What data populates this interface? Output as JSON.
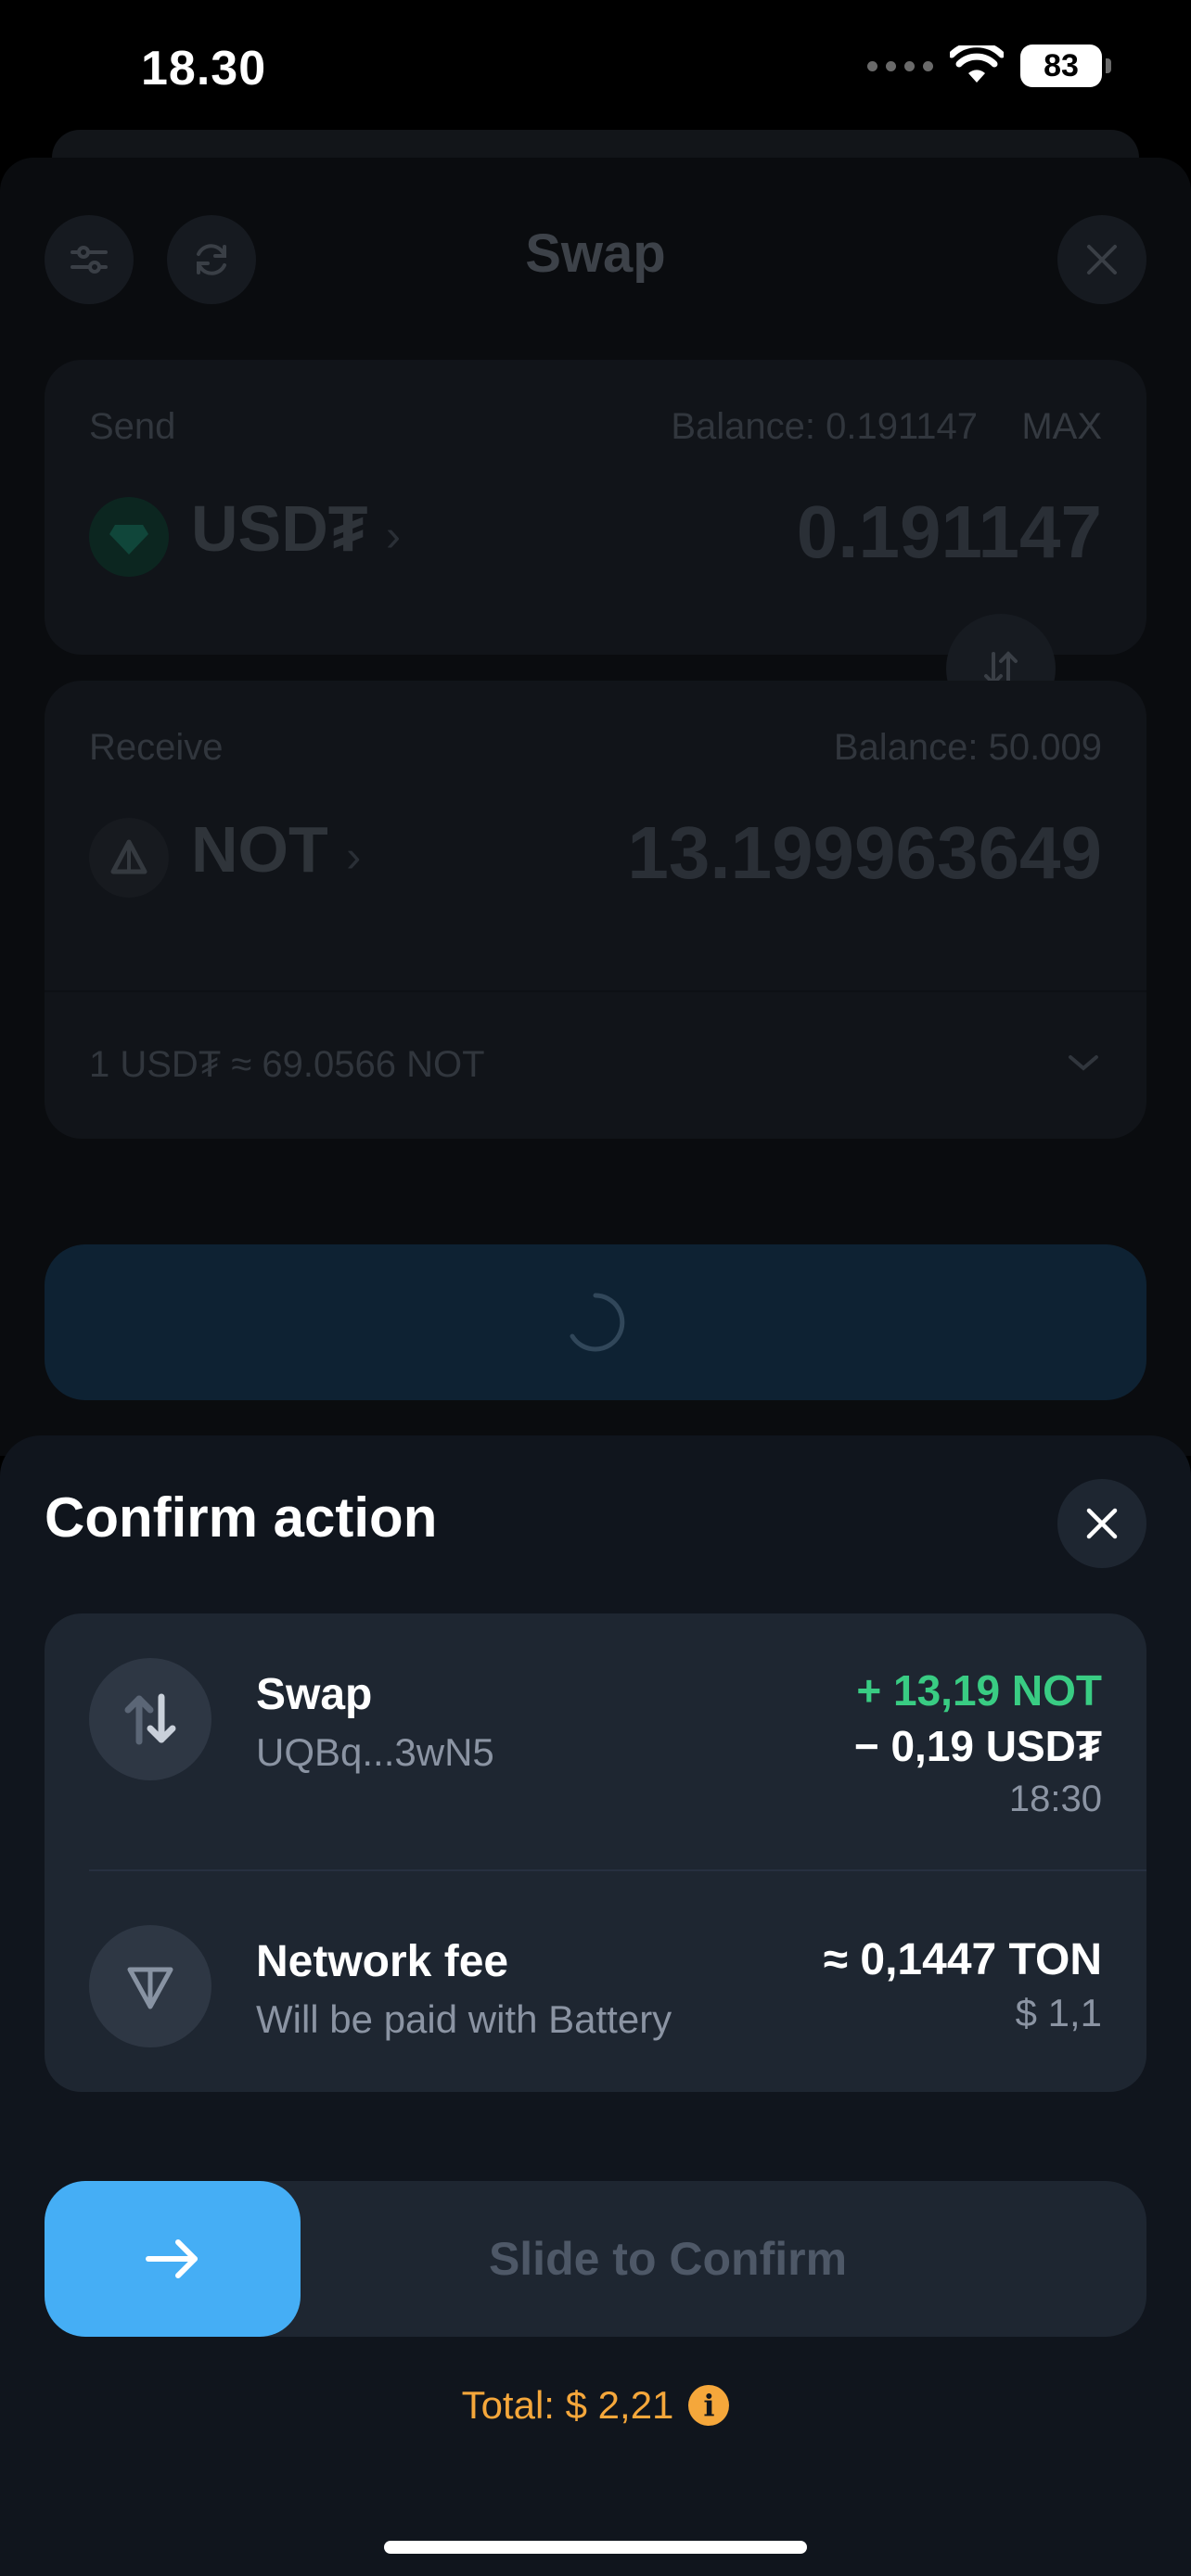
{
  "status_bar": {
    "time": "18.30",
    "battery": "83"
  },
  "swap_screen": {
    "title": "Swap",
    "send": {
      "label": "Send",
      "balance": "Balance: 0.191147",
      "max": "MAX",
      "token": "USD₮",
      "amount": "0.191147"
    },
    "receive": {
      "label": "Receive",
      "balance": "Balance: 50.009",
      "token": "NOT",
      "amount": "13.199963649"
    },
    "rate": "1 USD₮ ≈ 69.0566 NOT"
  },
  "confirm_sheet": {
    "title": "Confirm action",
    "swap_row": {
      "title": "Swap",
      "address": "UQBq...3wN5",
      "plus_amount": "+ 13,19 NOT",
      "minus_amount": "− 0,19 USD₮",
      "time": "18:30"
    },
    "fee_row": {
      "title": "Network fee",
      "subtitle": "Will be paid with Battery",
      "amount": "≈ 0,1447 TON",
      "usd": "$ 1,1"
    },
    "slider_label": "Slide to Confirm",
    "total": "Total: $ 2,21"
  },
  "colors": {
    "accent_blue": "#45aef5",
    "positive_green": "#39cc83",
    "total_orange": "#f5a73b",
    "sheet_bg": "#10151d",
    "card_bg": "#1e2631"
  }
}
